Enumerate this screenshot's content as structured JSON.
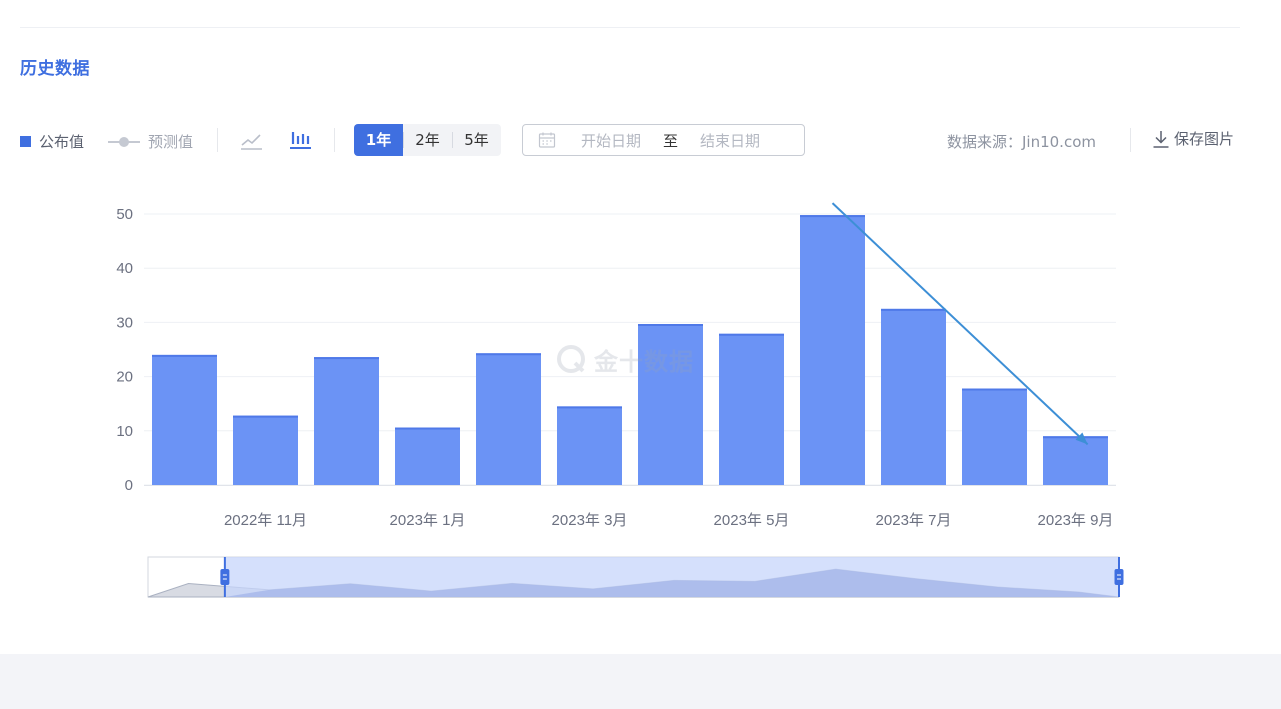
{
  "section": {
    "title": "历史数据"
  },
  "legend": {
    "published": "公布值",
    "forecast": "预测值"
  },
  "range_buttons": [
    {
      "label": "1年",
      "active": true
    },
    {
      "label": "2年",
      "active": false
    },
    {
      "label": "5年",
      "active": false
    }
  ],
  "date_range": {
    "start_placeholder": "开始日期",
    "separator": "至",
    "end_placeholder": "结束日期"
  },
  "source": "数据来源：Jin10.com",
  "save_label": "保存图片",
  "watermark": "金十数据",
  "colors": {
    "accent": "#3f6fe0",
    "bar": "#6b93f5",
    "annotation_arrow": "#3d8fd6",
    "slider_fill": "#c7d5fb"
  },
  "icons": {
    "line_chart": "line-chart-icon",
    "bar_chart": "bar-chart-icon",
    "calendar": "calendar-icon",
    "download": "download-icon"
  },
  "chart_data": {
    "type": "bar",
    "categories": [
      "2022-10",
      "2022-11",
      "2022-12",
      "2023-01",
      "2023-02",
      "2023-03",
      "2023-04",
      "2023-05",
      "2023-06",
      "2023-07",
      "2023-08",
      "2023-09"
    ],
    "values": [
      24.0,
      12.8,
      23.6,
      10.6,
      24.3,
      14.5,
      29.7,
      27.9,
      49.8,
      32.5,
      17.8,
      9.0
    ],
    "x_tick_labels": [
      {
        "index": 1,
        "label": "2022年 11月"
      },
      {
        "index": 3,
        "label": "2023年 1月"
      },
      {
        "index": 5,
        "label": "2023年 3月"
      },
      {
        "index": 7,
        "label": "2023年 5月"
      },
      {
        "index": 9,
        "label": "2023年 7月"
      },
      {
        "index": 11,
        "label": "2023年 9月"
      }
    ],
    "y_ticks": [
      "0",
      "10",
      "20",
      "30",
      "40",
      "50"
    ],
    "ylim": [
      0,
      50
    ],
    "grid": true,
    "annotation": {
      "type": "arrow",
      "from_index": 8,
      "from_value": 52,
      "to_index": 11.15,
      "to_value": 7.5
    },
    "data_zoom": {
      "start_index": 1,
      "end_index": 11
    }
  }
}
